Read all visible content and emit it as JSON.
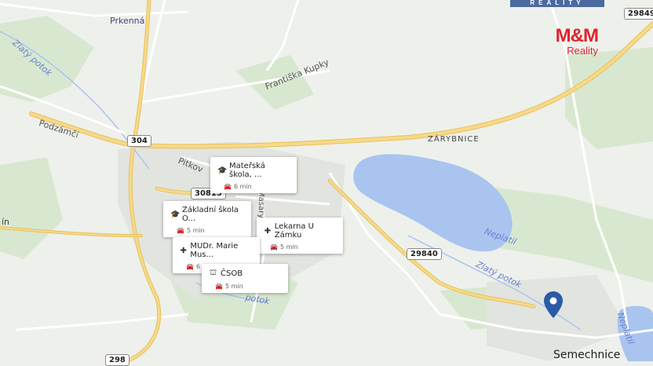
{
  "map": {
    "colors": {
      "background": "#eef0ec",
      "water": "#a9c4ef",
      "green": "#d8e8d0",
      "road_major": "#f6d98a",
      "road_edge": "#e8c25a",
      "road_minor": "#ffffff",
      "pin": "#2a5aa8",
      "brand": "#e0242e"
    }
  },
  "branding": {
    "top_strip": "REALITY",
    "logo": "M&M",
    "logo_sub": "Reality"
  },
  "labels": {
    "prkenna": "Prkenná",
    "zlaty_potok_1": "Zlatý potok",
    "frantiska_kupky": "Františka Kupky",
    "podzamci": "Podzámčí",
    "pitkov": "Pitkov",
    "zarybnice": "ZÁRYBNICE",
    "neplatil": "Neplatil",
    "zlaty_potok_2": "Zlatý potok",
    "zlaty_potok_3": "potok",
    "semechnice": "Semechnice",
    "neplatil_2": "Neplatil",
    "masarykova": "Masarykova",
    "left_edge": "ín",
    "top_label": "Prkenná"
  },
  "roads": {
    "r304": "304",
    "r30815": "30815",
    "r29840": "29840",
    "r29849": "29849",
    "r298": "298"
  },
  "pois": [
    {
      "name": "Mateřská škola, ...",
      "time": "6 min",
      "icon": "school-icon"
    },
    {
      "name": "Základní škola O...",
      "time": "5 min",
      "icon": "school-icon"
    },
    {
      "name": "Lekarna U Zámku",
      "time": "5 min",
      "icon": "pharmacy-icon"
    },
    {
      "name": "MUDr. Marie Mus...",
      "time": "6 min",
      "icon": "medical-icon"
    },
    {
      "name": "ČSOB",
      "time": "5 min",
      "icon": "bank-icon"
    }
  ]
}
